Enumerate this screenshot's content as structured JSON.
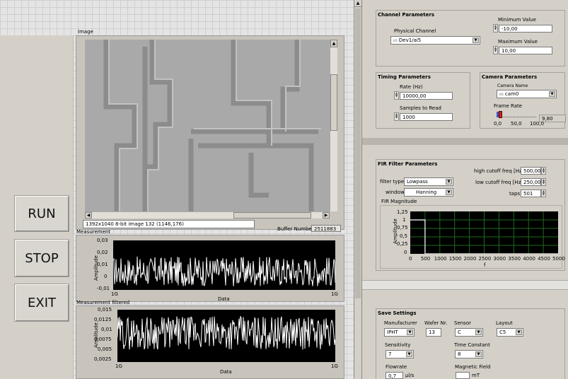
{
  "buttons": {
    "run": "RUN",
    "stop": "STOP",
    "exit": "EXIT"
  },
  "image_panel": {
    "label": "Image",
    "status": "1392x1040 8-bit image 132    (1146,176)",
    "buffer_label": "Buffer Number",
    "buffer_value": "2511883"
  },
  "measurement": {
    "title": "Measurement",
    "yticks": [
      "0,03",
      "0,02",
      "0,01",
      "0",
      "-0,01"
    ],
    "xticks": [
      "1G",
      "1G"
    ],
    "xlabel": "Data",
    "ylabel": "Amplitude"
  },
  "measurement_filtered": {
    "title": "Measurement filtered",
    "yticks": [
      "0,015",
      "0,0125",
      "0,01",
      "0,0075",
      "0,005",
      "0,0025"
    ],
    "xticks": [
      "1G",
      "1G"
    ],
    "xlabel": "Data",
    "ylabel": "Amplitude"
  },
  "channel": {
    "title": "Channel Parameters",
    "physical_label": "Physical Channel",
    "physical_value": "Dev1/ai5",
    "physical_prefix": "I/O",
    "min_label": "Minimum Value",
    "min_value": "-10,00",
    "max_label": "Maximum Value",
    "max_value": "10,00"
  },
  "timing": {
    "title": "Timing Parameters",
    "rate_label": "Rate (Hz)",
    "rate_value": "10000,00",
    "samples_label": "Samples to Read",
    "samples_value": "1000"
  },
  "camera": {
    "title": "Camera Parameters",
    "name_label": "Camera Name",
    "name_value": "cam0",
    "name_prefix": "I/O",
    "rate_label": "Frame Rate",
    "rate_value": "9,80",
    "ticks": [
      "0,0",
      "50,0",
      "100,0"
    ],
    "frame_rate": 9.8
  },
  "fir": {
    "title": "FIR Filter Parameters",
    "type_label": "filter type",
    "type_value": "Lowpass",
    "window_label": "window",
    "window_value": "Hanning",
    "high_label": "high cutoff freq [Hz]",
    "high_value": "500,00",
    "low_label": "low cutoff freq [Hz]",
    "low_value": "250,00",
    "taps_label": "taps",
    "taps_value": "501",
    "mag_title": "FIR Magnitude",
    "ylabel": "Amplitude",
    "xlabel": "f",
    "yticks": [
      "1,25",
      "1",
      "0,75",
      "0,5",
      "0,25",
      "0"
    ],
    "xticks": [
      "0",
      "500",
      "1000",
      "1500",
      "2000",
      "2500",
      "3000",
      "3500",
      "4000",
      "4500",
      "5000"
    ]
  },
  "save": {
    "title": "Save Settings",
    "manufacturer_label": "Manufacturer",
    "manufacturer_value": "IPHT",
    "wafer_label": "Wafer Nr.",
    "wafer_value": "13",
    "sensor_label": "Sensor",
    "sensor_value": "C",
    "layout_label": "Layout",
    "layout_value": "C5",
    "sensitivity_label": "Sensitivity",
    "sensitivity_value": "7",
    "time_label": "Time Constant",
    "time_value": "8",
    "flow_label": "Flowrate",
    "flow_value": "0,7",
    "flow_unit": "µl/s",
    "mag_label": "Magnetic Field",
    "mag_value": "",
    "mag_unit": "mT"
  },
  "chart_data": [
    {
      "type": "line",
      "title": "Measurement",
      "xlabel": "Data",
      "ylabel": "Amplitude",
      "ylim": [
        -0.01,
        0.03
      ],
      "series": [
        {
          "values": [
            0.005
          ]
        }
      ]
    },
    {
      "type": "line",
      "title": "Measurement filtered",
      "xlabel": "Data",
      "ylabel": "Amplitude",
      "ylim": [
        0.0025,
        0.015
      ],
      "series": [
        {
          "values": [
            0.0095
          ]
        }
      ]
    },
    {
      "type": "line",
      "title": "FIR Magnitude",
      "xlabel": "f",
      "ylabel": "Amplitude",
      "xlim": [
        0,
        5000
      ],
      "ylim": [
        0,
        1.25
      ],
      "x": [
        0,
        250,
        500,
        500,
        5000
      ],
      "series": [
        {
          "values": [
            1,
            1,
            1,
            0,
            0
          ]
        }
      ]
    }
  ]
}
